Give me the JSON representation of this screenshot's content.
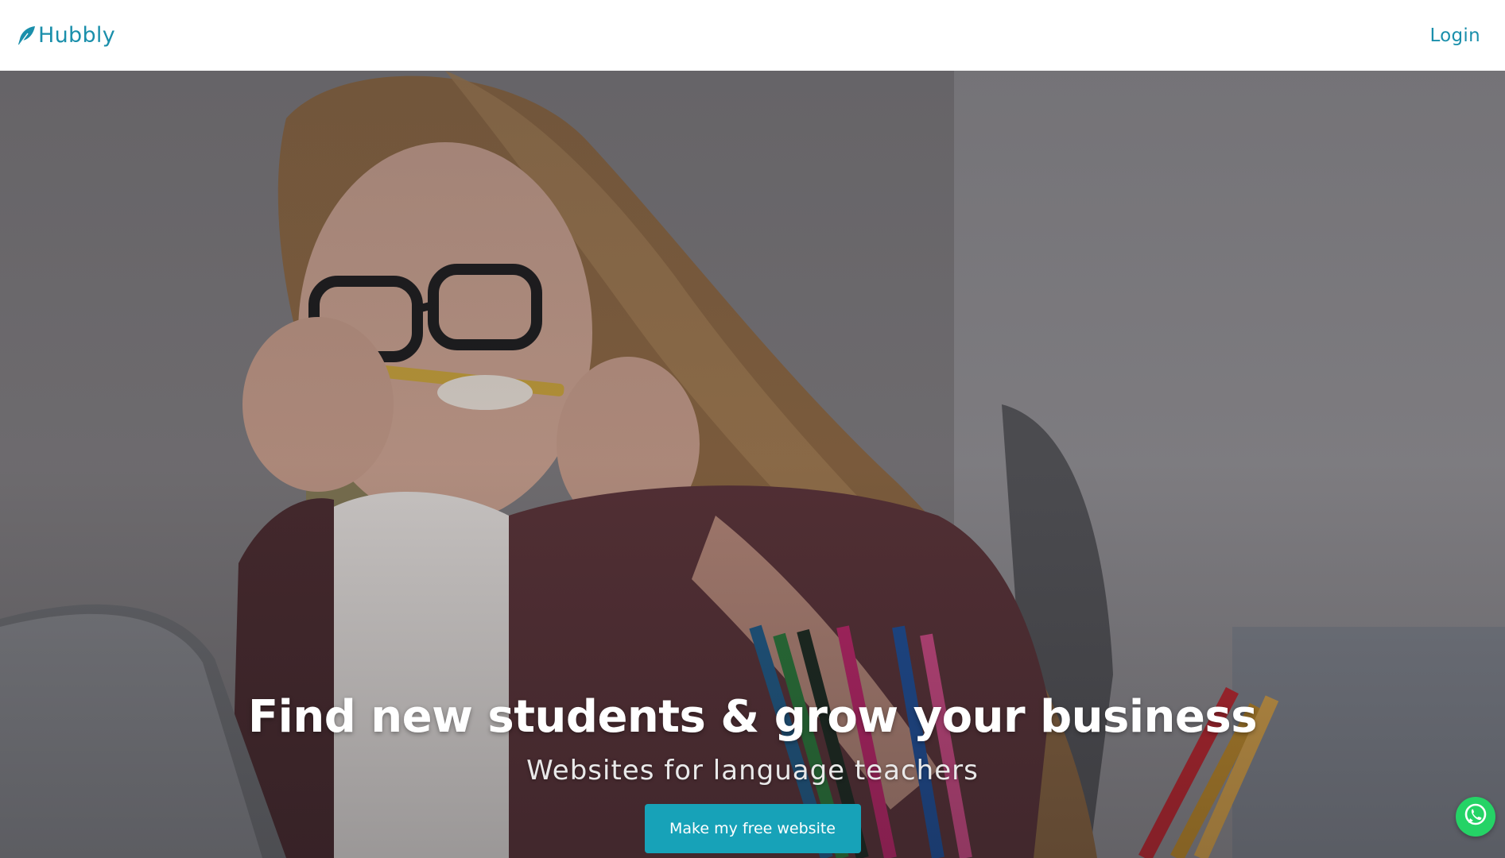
{
  "navbar": {
    "brand": "Hubbly",
    "brand_icon": "feather-icon",
    "login_label": "Login"
  },
  "hero": {
    "title": "Find new students & grow your business",
    "subtitle": "Websites for language teachers",
    "cta_label": "Make my free website",
    "background_image": "woman-biting-pencil-photo"
  },
  "floating": {
    "whatsapp_icon": "whatsapp-icon"
  },
  "colors": {
    "brand": "#1a8fab",
    "cta": "#17a2b8",
    "whatsapp": "#25d366"
  }
}
